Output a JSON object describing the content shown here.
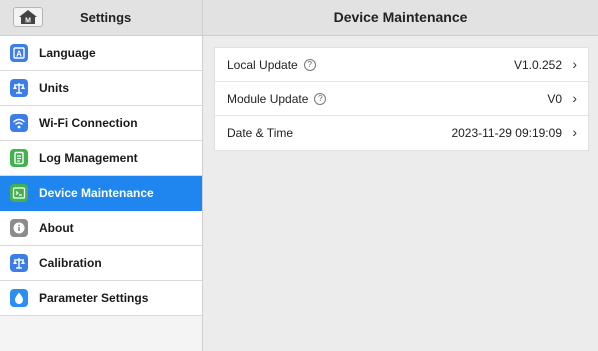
{
  "header": {
    "settings_title": "Settings",
    "page_title": "Device Maintenance"
  },
  "sidebar": {
    "items": [
      {
        "label": "Language",
        "icon": "language-icon",
        "color": "#3d7de8"
      },
      {
        "label": "Units",
        "icon": "scale-icon",
        "color": "#3d7de8"
      },
      {
        "label": "Wi-Fi Connection",
        "icon": "wifi-icon",
        "color": "#3d7de8"
      },
      {
        "label": "Log Management",
        "icon": "document-icon",
        "color": "#43b14e"
      },
      {
        "label": "Device Maintenance",
        "icon": "terminal-icon",
        "color": "#43b14e"
      },
      {
        "label": "About",
        "icon": "info-icon",
        "color": "#8c8c8c"
      },
      {
        "label": "Calibration",
        "icon": "scale-icon",
        "color": "#3d7de8"
      },
      {
        "label": "Parameter Settings",
        "icon": "drop-icon",
        "color": "#2a8ef2"
      }
    ],
    "active_index": 4
  },
  "rows": [
    {
      "label": "Local Update",
      "value": "V1.0.252",
      "help": "?"
    },
    {
      "label": "Module Update",
      "value": "V0",
      "help": "?"
    },
    {
      "label": "Date & Time",
      "value": "2023-11-29 09:19:09"
    }
  ],
  "chevron": "›",
  "colors": {
    "active_bg": "#1f86f0",
    "header_bg": "#e2e2e2",
    "content_bg": "#ececec"
  }
}
